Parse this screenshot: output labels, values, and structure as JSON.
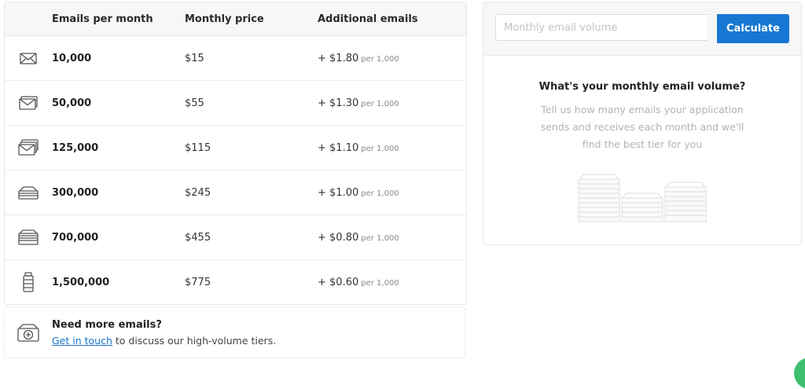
{
  "table": {
    "headers": {
      "emails": "Emails per month",
      "price": "Monthly price",
      "additional": "Additional emails"
    },
    "rows": [
      {
        "icon": "envelope-icon",
        "emails": "10,000",
        "price": "$15",
        "additional": "+ $1.80",
        "per": "per 1,000"
      },
      {
        "icon": "envelope-stack-small-icon",
        "emails": "50,000",
        "price": "$55",
        "additional": "+ $1.30",
        "per": "per 1,000"
      },
      {
        "icon": "envelope-stack-medium-icon",
        "emails": "125,000",
        "price": "$115",
        "additional": "+ $1.10",
        "per": "per 1,000"
      },
      {
        "icon": "envelope-tray-icon",
        "emails": "300,000",
        "price": "$245",
        "additional": "+ $1.00",
        "per": "per 1,000"
      },
      {
        "icon": "envelope-box-icon",
        "emails": "700,000",
        "price": "$455",
        "additional": "+ $0.80",
        "per": "per 1,000"
      },
      {
        "icon": "mail-container-icon",
        "emails": "1,500,000",
        "price": "$775",
        "additional": "+ $0.60",
        "per": "per 1,000"
      }
    ]
  },
  "more": {
    "icon": "mailbox-plus-icon",
    "title": "Need more emails?",
    "link_text": "Get in touch",
    "text": " to discuss our high-volume tiers."
  },
  "calculator": {
    "placeholder": "Monthly email volume",
    "value": "",
    "button_label": "Calculate",
    "heading": "What's your monthly email volume?",
    "description": "Tell us how many emails your application sends and receives each month and we'll find the best tier for you",
    "illustration_icon": "envelope-stacks-illustration"
  },
  "colors": {
    "accent": "#1677d2",
    "link": "#1a73c9",
    "fab": "#3dbf6e"
  }
}
